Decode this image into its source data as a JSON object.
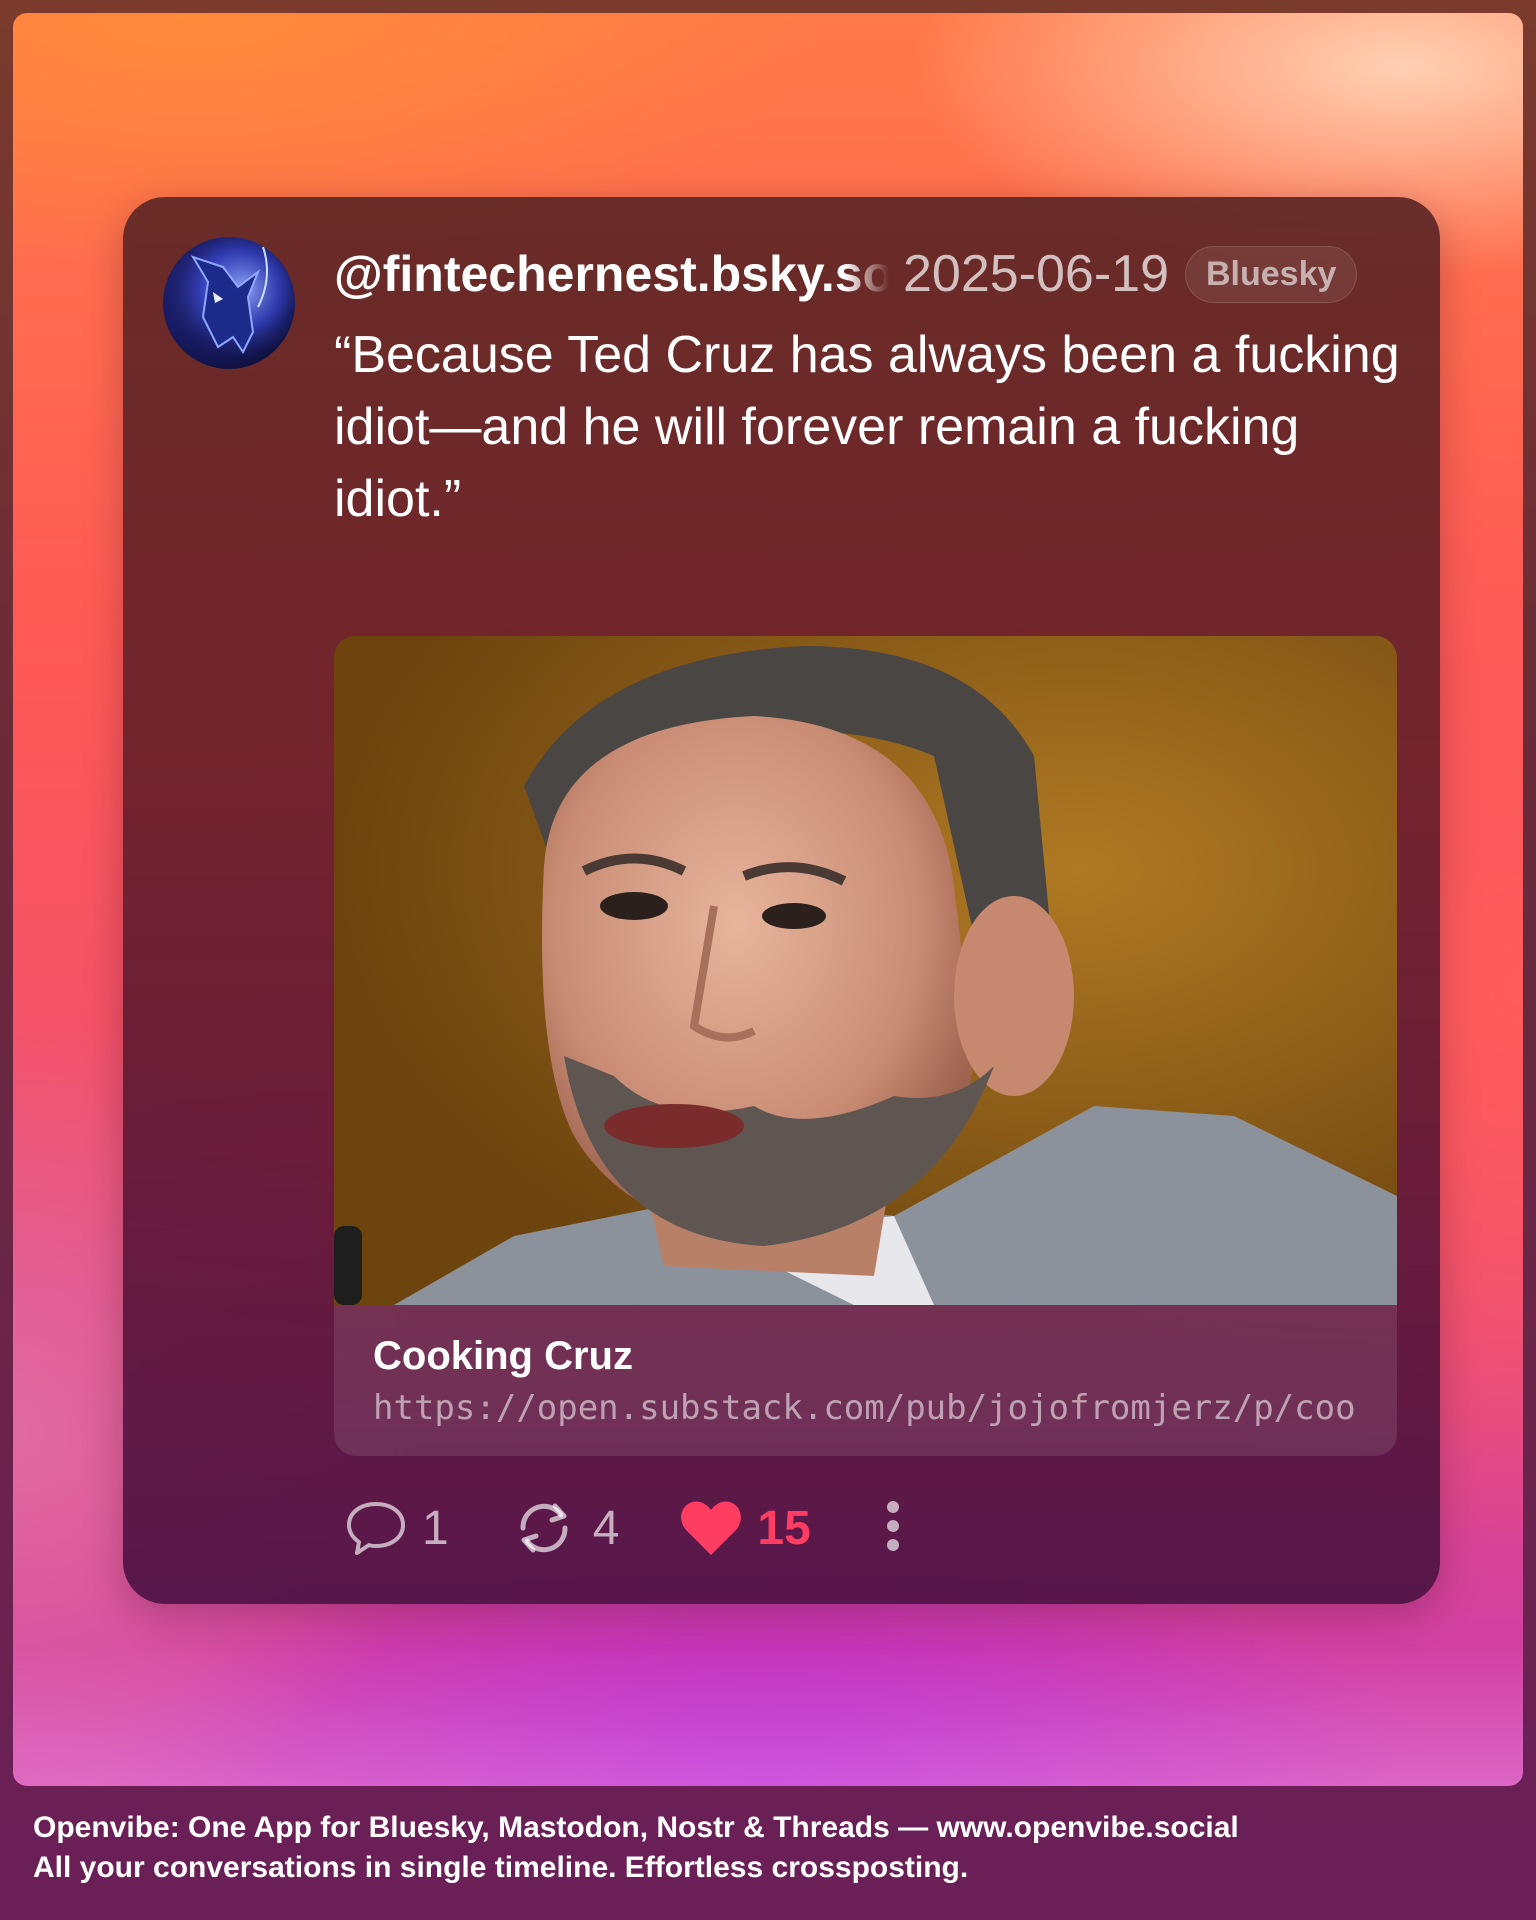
{
  "post": {
    "handle": "@fintechernest.bsky.social",
    "date": "2025-06-19",
    "network": "Bluesky",
    "text": "“Because Ted Cruz has always been a fucking idiot—and he will forever remain a fucking idiot.”",
    "avatar_icon": "wolf-avatar-icon"
  },
  "link_preview": {
    "title": "Cooking Cruz",
    "url": "https://open.substack.com/pub/jojofromjerz/p/coo...",
    "image_subject": "man-in-gray-suit-photo"
  },
  "actions": {
    "reply_count": "1",
    "repost_count": "4",
    "like_count": "15",
    "reply_icon": "speech-bubble-icon",
    "repost_icon": "repost-arrows-icon",
    "like_icon": "heart-icon",
    "more_icon": "vertical-dots-icon"
  },
  "colors": {
    "like_accent": "#ff3d63",
    "card_background": "#5c2426"
  },
  "footer": {
    "line1": "Openvibe: One App for Bluesky, Mastodon, Nostr & Threads — www.openvibe.social",
    "line2": "All your conversations in single timeline. Effortless crossposting."
  }
}
